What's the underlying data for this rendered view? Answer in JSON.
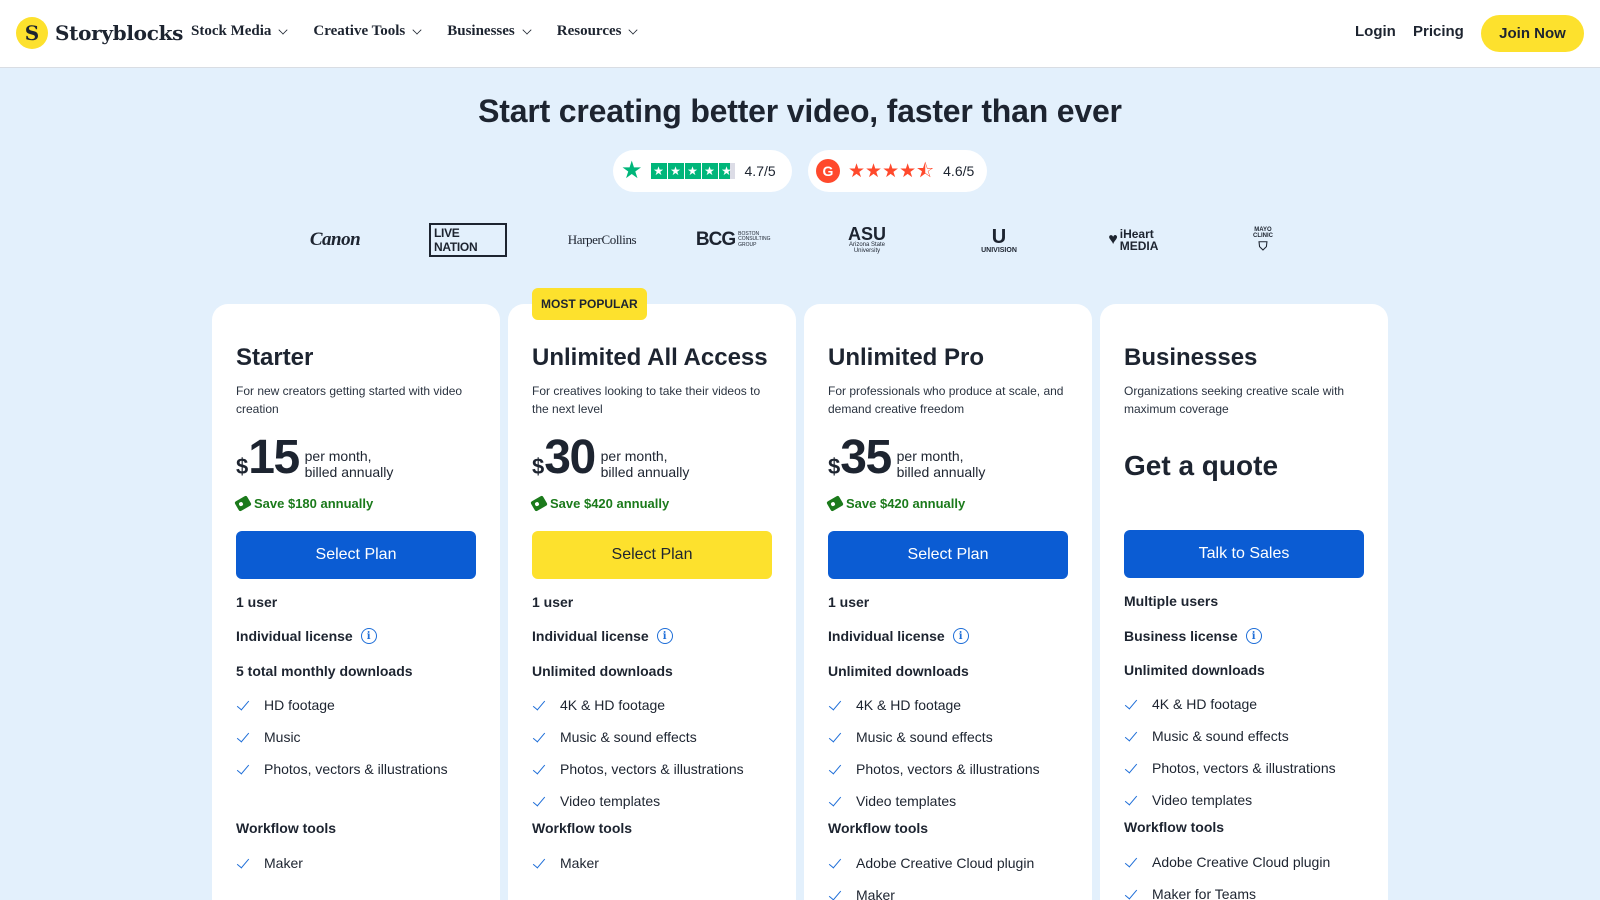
{
  "header": {
    "brand": "Storyblocks",
    "brand_mark": "S",
    "nav": [
      "Stock Media",
      "Creative Tools",
      "Businesses",
      "Resources"
    ],
    "login": "Login",
    "pricing": "Pricing",
    "join": "Join Now"
  },
  "hero": {
    "title": "Start creating better video, faster than ever",
    "trustpilot_rating": "4.7/5",
    "g2_rating": "4.6/5",
    "g2_mark": "G"
  },
  "clients": {
    "canon": "Canon",
    "livenation": "LIVE NATION",
    "harpercollins": "HarperCollins",
    "bcg": "BCG",
    "bcg_sub": "BOSTON CONSULTING GROUP",
    "asu": "ASU",
    "asu_sub": "Arizona State University",
    "univision_mark": "U",
    "univision": "UNIVISION",
    "iheart": "iHeart MEDIA",
    "mayo": "MAYO CLINIC"
  },
  "badge": "MOST POPULAR",
  "plans": [
    {
      "name": "Starter",
      "desc": "For new creators getting started with video creation",
      "currency": "$",
      "amount": "15",
      "per1": "per month,",
      "per2": "billed annually",
      "save": "Save $180 annually",
      "cta": "Select Plan",
      "users": "1 user",
      "license": "Individual license",
      "downloads": "5 total monthly downloads",
      "features": [
        "HD footage",
        "Music",
        "Photos, vectors & illustrations"
      ],
      "workflow_title": "Workflow tools",
      "workflow": [
        "Maker"
      ]
    },
    {
      "name": "Unlimited All Access",
      "desc": "For creatives looking to take their videos to the next level",
      "currency": "$",
      "amount": "30",
      "per1": "per month,",
      "per2": "billed annually",
      "save": "Save $420 annually",
      "cta": "Select Plan",
      "users": "1 user",
      "license": "Individual license",
      "downloads": "Unlimited downloads",
      "features": [
        "4K & HD footage",
        "Music & sound effects",
        "Photos, vectors & illustrations",
        "Video templates"
      ],
      "workflow_title": "Workflow tools",
      "workflow": [
        "Maker"
      ]
    },
    {
      "name": "Unlimited Pro",
      "desc": "For professionals who produce at scale, and demand creative freedom",
      "currency": "$",
      "amount": "35",
      "per1": "per month,",
      "per2": "billed annually",
      "save": "Save $420 annually",
      "cta": "Select Plan",
      "users": "1 user",
      "license": "Individual license",
      "downloads": "Unlimited downloads",
      "features": [
        "4K & HD footage",
        "Music & sound effects",
        "Photos, vectors & illustrations",
        "Video templates"
      ],
      "workflow_title": "Workflow tools",
      "workflow": [
        "Adobe Creative Cloud plugin",
        "Maker"
      ]
    },
    {
      "name": "Businesses",
      "desc": "Organizations seeking creative scale with maximum coverage",
      "quote": "Get a quote",
      "cta": "Talk to Sales",
      "users": "Multiple users",
      "license": "Business license",
      "downloads": "Unlimited downloads",
      "features": [
        "4K & HD footage",
        "Music & sound effects",
        "Photos, vectors & illustrations",
        "Video templates"
      ],
      "workflow_title": "Workflow tools",
      "workflow": [
        "Adobe Creative Cloud plugin",
        "Maker for Teams"
      ]
    }
  ],
  "info_glyph": "i",
  "colors": {
    "page_bg": "#e3f0fc",
    "brand_yellow": "#fde12d",
    "primary_blue": "#0b5cd3",
    "savings_green": "#1b7a1b",
    "trustpilot_green": "#00b67a",
    "g2_red": "#ff492c"
  }
}
